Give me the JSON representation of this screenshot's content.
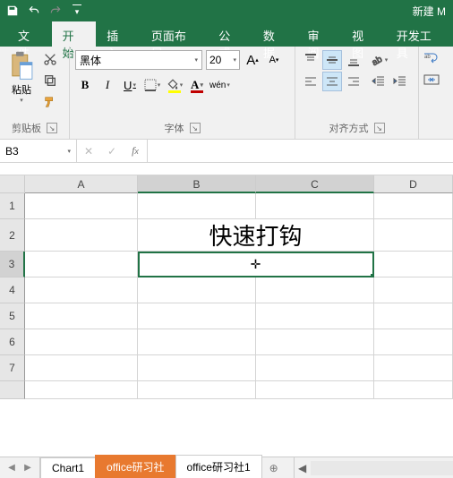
{
  "titlebar": {
    "doc_title": "新建 M"
  },
  "tabs": {
    "file": "文件",
    "home": "开始",
    "insert": "插入",
    "layout": "页面布局",
    "formulas": "公式",
    "data": "数据",
    "review": "审阅",
    "view": "视图",
    "dev": "开发工具"
  },
  "ribbon": {
    "clipboard": {
      "paste": "粘贴",
      "group_label": "剪贴板"
    },
    "font": {
      "name": "黑体",
      "size": "20",
      "grow": "A",
      "shrink": "A",
      "bold": "B",
      "italic": "I",
      "underline": "U",
      "phonetic": "wén",
      "group_label": "字体"
    },
    "alignment": {
      "group_label": "对齐方式"
    }
  },
  "namebox": {
    "ref": "B3"
  },
  "columns": [
    "A",
    "B",
    "C",
    "D"
  ],
  "rows": [
    "1",
    "2",
    "3",
    "4",
    "5",
    "6",
    "7"
  ],
  "cells": {
    "b2_merged": "快速打钩"
  },
  "cursor_glyph": "✛",
  "sheets": {
    "chart1": "Chart1",
    "active": "office研习社",
    "sheet2": "office研习社1"
  },
  "colors": {
    "brand": "#217346",
    "tab_active": "#e8792f",
    "font_color": "#c00000",
    "fill_color": "#ffff00"
  }
}
